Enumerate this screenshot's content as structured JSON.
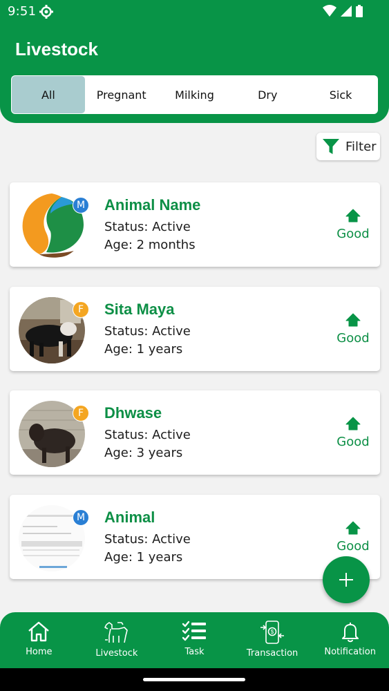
{
  "status_bar": {
    "time": "9:51"
  },
  "app": {
    "title": "Livestock"
  },
  "tabs": [
    {
      "label": "All",
      "active": true
    },
    {
      "label": "Pregnant",
      "active": false
    },
    {
      "label": "Milking",
      "active": false
    },
    {
      "label": "Dry",
      "active": false
    },
    {
      "label": "Sick",
      "active": false
    }
  ],
  "filter": {
    "label": "Filter",
    "icon": "filter-icon"
  },
  "animals": [
    {
      "name": "Animal Name",
      "status": "Status: Active",
      "age": "Age: 2 months",
      "gender_badge": "M",
      "health": "Good",
      "trend_icon": "arrow-up-icon",
      "photo": "app-logo"
    },
    {
      "name": "Sita Maya",
      "status": "Status: Active",
      "age": "Age: 1 years",
      "gender_badge": "F",
      "health": "Good",
      "trend_icon": "arrow-up-icon",
      "photo": "black-white-cow-photo"
    },
    {
      "name": "Dhwase",
      "status": "Status: Active",
      "age": "Age: 3 years",
      "gender_badge": "F",
      "health": "Good",
      "trend_icon": "arrow-up-icon",
      "photo": "dark-cow-photo"
    },
    {
      "name": "Animal",
      "status": "Status: Active",
      "age": "Age: 1 years",
      "gender_badge": "M",
      "health": "Good",
      "trend_icon": "arrow-up-icon",
      "photo": "document-screenshot"
    }
  ],
  "fab": {
    "icon": "plus-icon"
  },
  "bottom_nav": [
    {
      "label": "Home",
      "icon": "home-icon"
    },
    {
      "label": "Livestock",
      "icon": "livestock-icon"
    },
    {
      "label": "Task",
      "icon": "task-list-icon"
    },
    {
      "label": "Transaction",
      "icon": "transaction-icon"
    },
    {
      "label": "Notification",
      "icon": "bell-icon"
    }
  ],
  "colors": {
    "primary": "#089447",
    "accent_text": "#0d8f46",
    "active_tab": "#a9cccf",
    "male_badge": "#2a7fd4",
    "female_badge": "#f4a622"
  }
}
